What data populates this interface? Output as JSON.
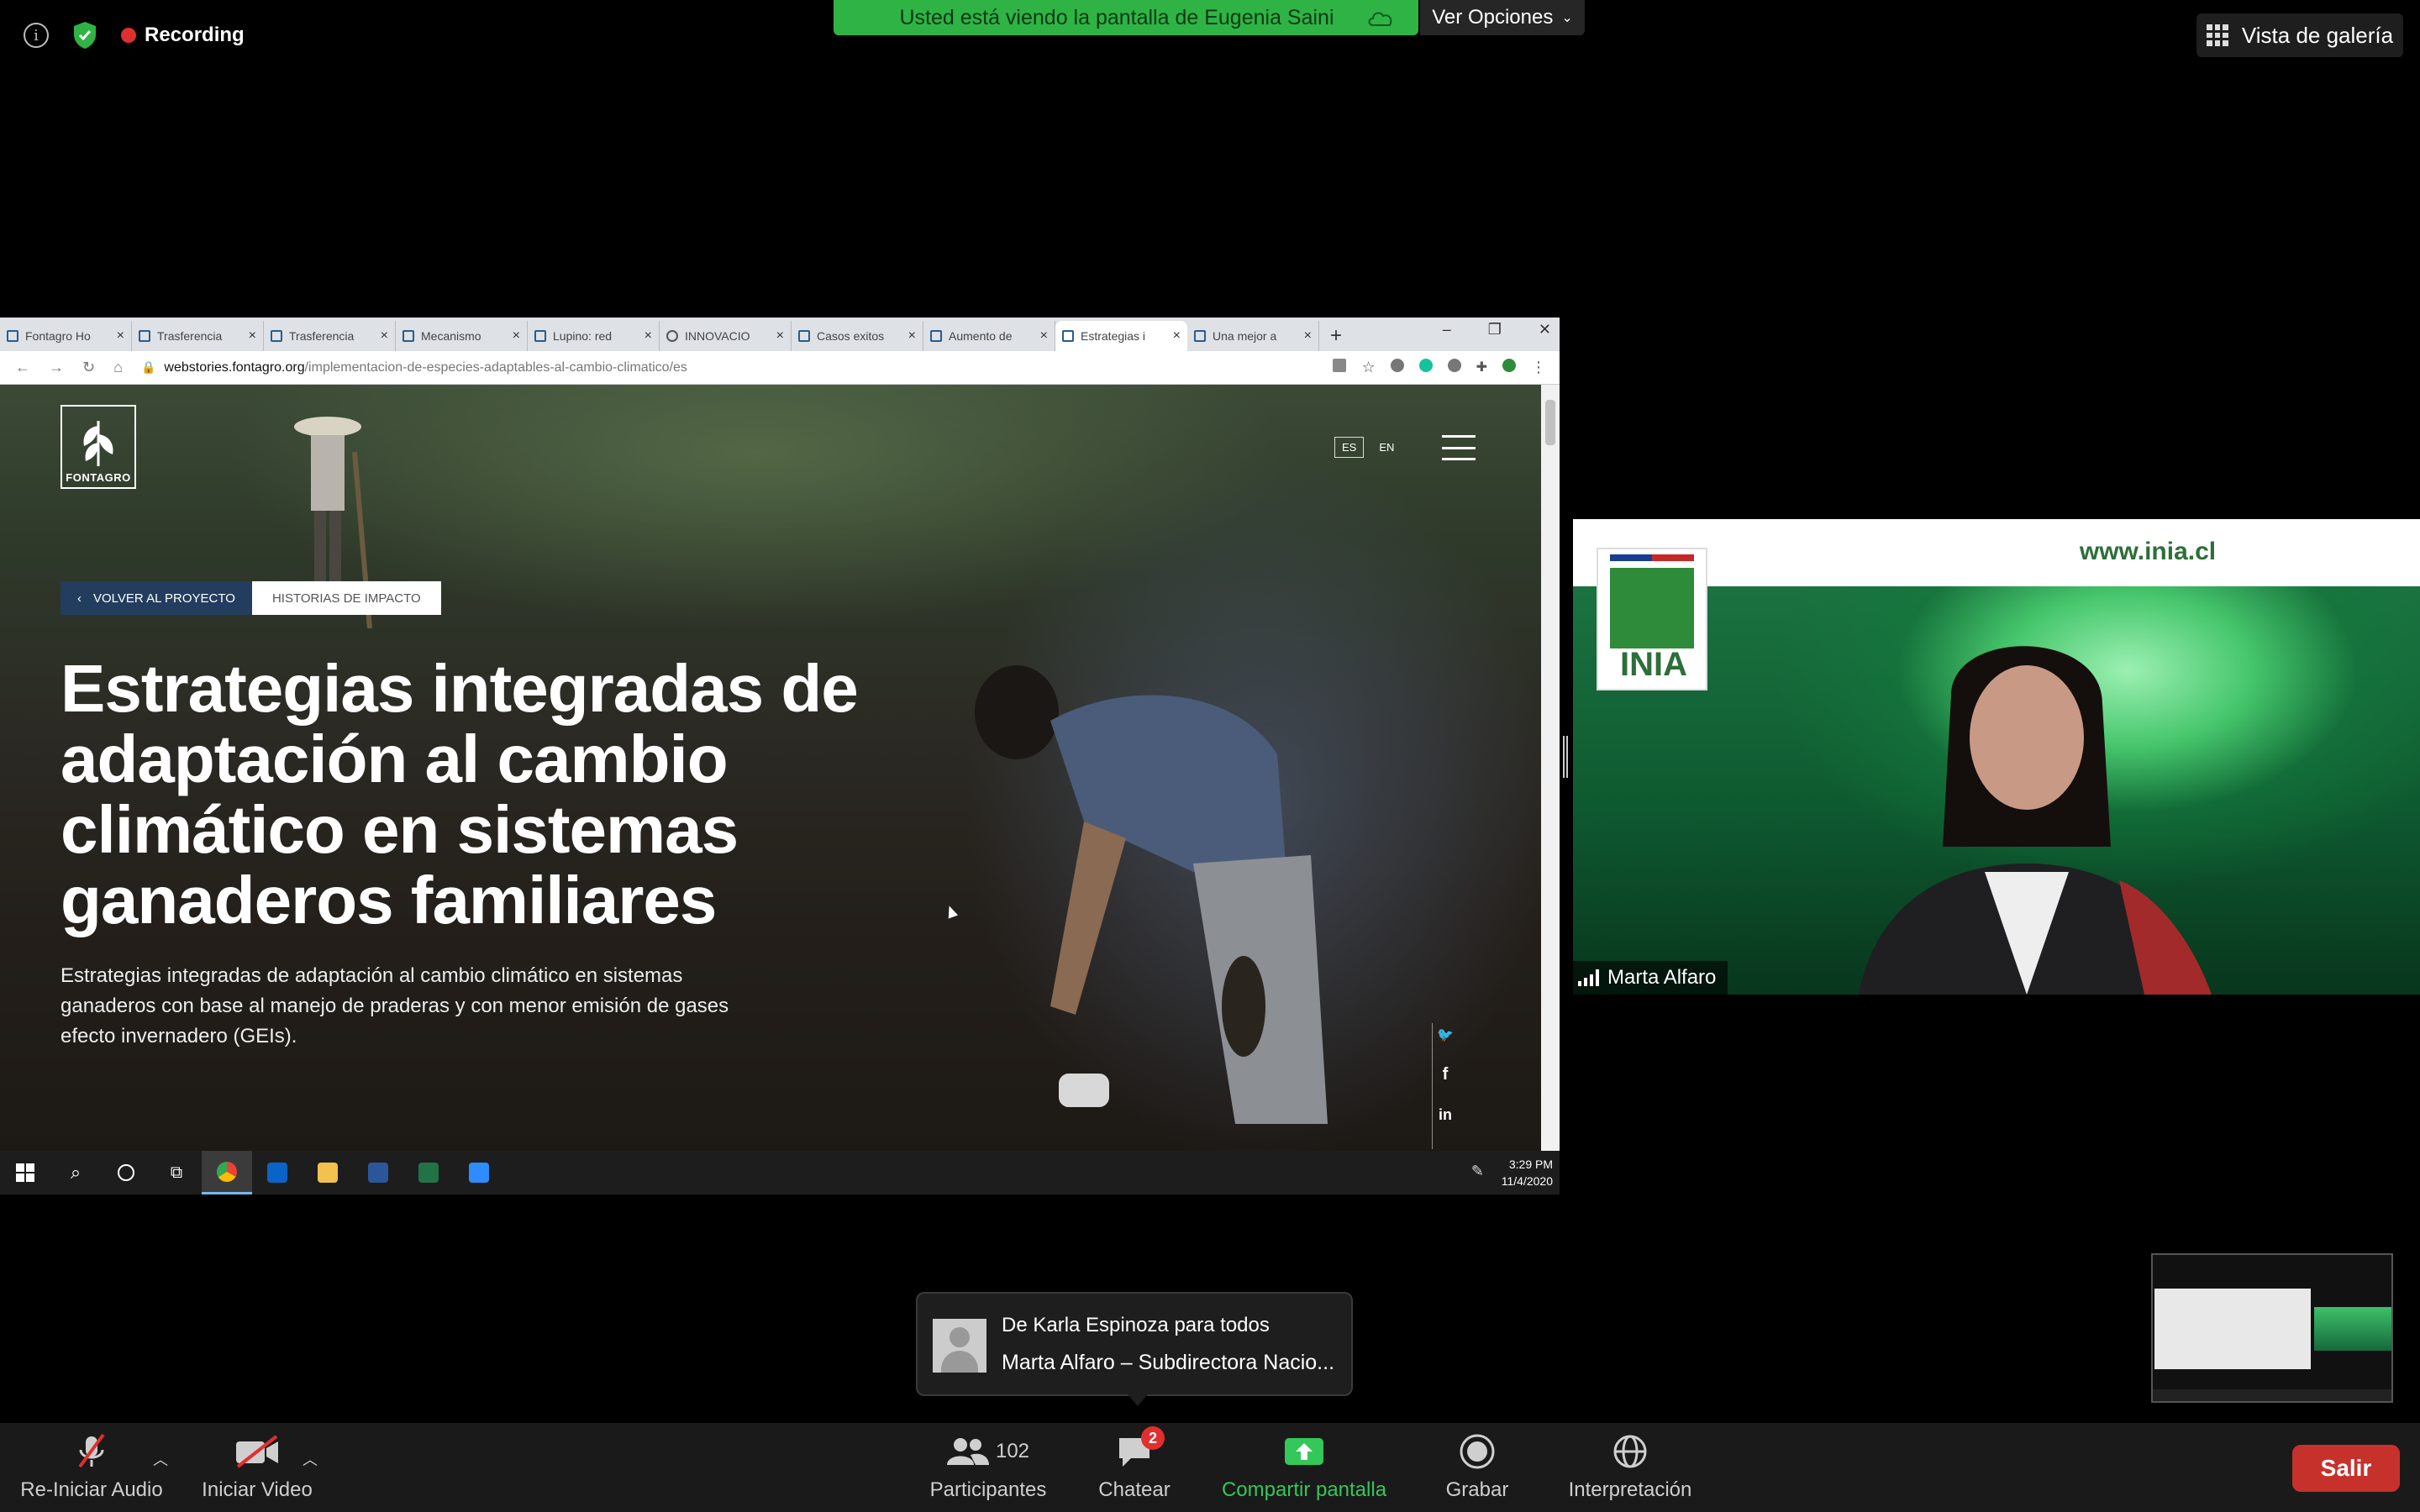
{
  "top": {
    "recording_label": "Recording",
    "share_banner": "Usted está viendo la pantalla de Eugenia Saini",
    "options_label": "Ver Opciones",
    "gallery_label": "Vista de galería"
  },
  "browser": {
    "tabs": [
      {
        "title": "Fontagro Ho"
      },
      {
        "title": "Trasferencia"
      },
      {
        "title": "Trasferencia"
      },
      {
        "title": "Mecanismo"
      },
      {
        "title": "Lupino: red"
      },
      {
        "title": "INNOVACIO"
      },
      {
        "title": "Casos exitos"
      },
      {
        "title": "Aumento de"
      },
      {
        "title": "Estrategias i"
      },
      {
        "title": "Una mejor a"
      }
    ],
    "url_host": "webstories.fontagro.org",
    "url_path": "/implementacion-de-especies-adaptables-al-cambio-climatico/es"
  },
  "page": {
    "logo_text": "FONTAGRO",
    "lang_es": "ES",
    "lang_en": "EN",
    "back_label": "VOLVER AL PROYECTO",
    "impact_label": "HISTORIAS DE IMPACTO",
    "headline": "Estrategias integradas de adaptación al cambio climático en sistemas ganaderos familiares",
    "description": "Estrategias integradas de adaptación al cambio climático en sistemas ganaderos con base al manejo de praderas y con menor emisión de gases efecto invernadero (GEIs).",
    "social": {
      "twitter": "🐦",
      "facebook": "f",
      "linkedin": "in"
    }
  },
  "taskbar": {
    "time": "3:29 PM",
    "date": "11/4/2020"
  },
  "video": {
    "banner_url": "www.inia.cl",
    "logo_text": "INIA",
    "participant_name": "Marta Alfaro"
  },
  "chat_toast": {
    "from": "De Karla Espinoza para todos",
    "message": "Marta Alfaro – Subdirectora Nacio..."
  },
  "toolbar": {
    "audio_label": "Re-Iniciar Audio",
    "video_label": "Iniciar Video",
    "participants_label": "Participantes",
    "participants_count": "102",
    "chat_label": "Chatear",
    "chat_badge": "2",
    "share_label": "Compartir pantalla",
    "record_label": "Grabar",
    "interp_label": "Interpretación",
    "leave_label": "Salir"
  },
  "colors": {
    "share_banner_bg": "#2fb345",
    "leave_bg": "#c7312c",
    "share_icon": "#34c759",
    "recording_dot": "#e02f2f"
  }
}
